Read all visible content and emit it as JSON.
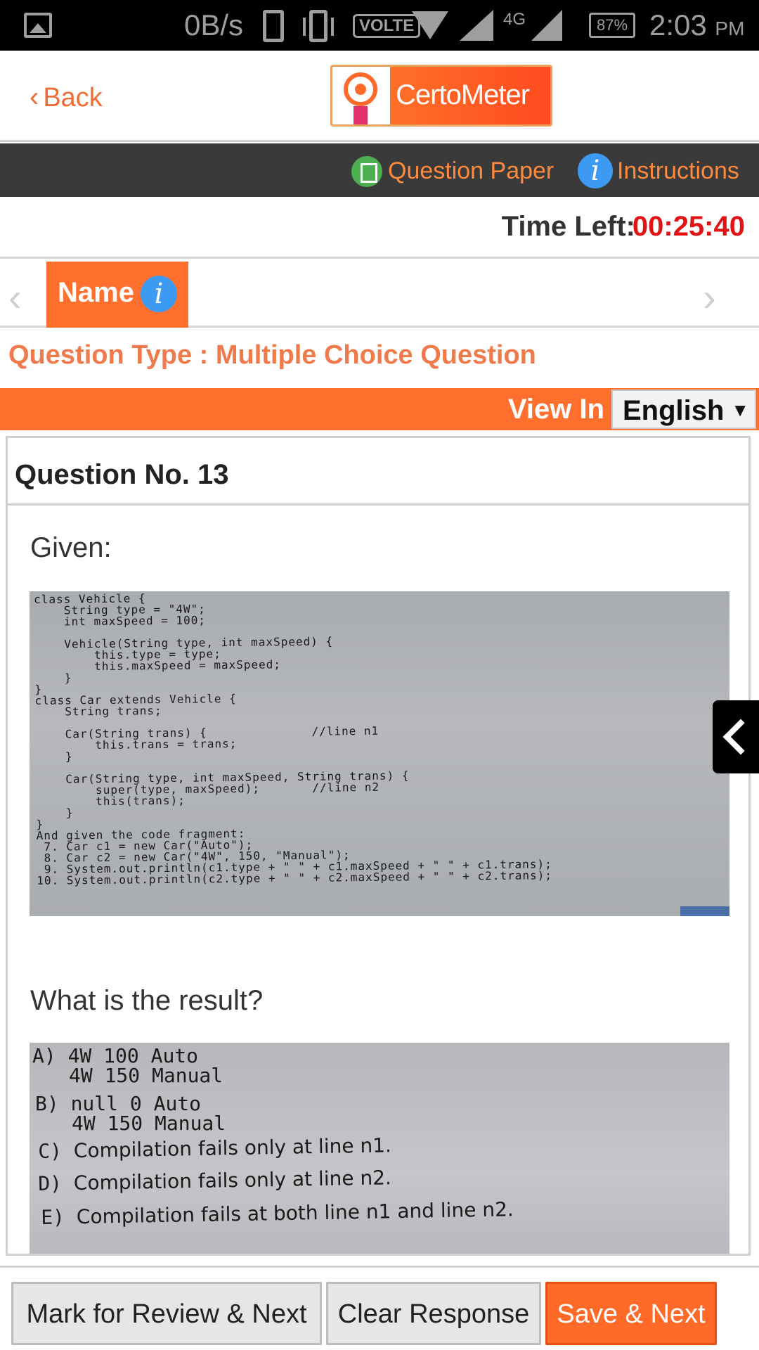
{
  "status_bar": {
    "speed": "0B/s",
    "volte": "VOLTE",
    "network": "4G",
    "battery": "87%",
    "time": "2:03",
    "ampm": "PM"
  },
  "header": {
    "back_label": "Back",
    "brand": "CertoMeter"
  },
  "toolbar": {
    "question_paper_label": "Question Paper",
    "instructions_label": "Instructions"
  },
  "timer": {
    "label": "Time Left:",
    "value": "00:25:40"
  },
  "section_tab": {
    "name": "Name"
  },
  "question_type": "Question Type : Multiple Choice Question",
  "view_in": {
    "label": "View In",
    "language": "English"
  },
  "question": {
    "number_label": "Question No. 13",
    "given": "Given:",
    "code": "class Vehicle {\n    String type = \"4W\";\n    int maxSpeed = 100;\n\n    Vehicle(String type, int maxSpeed) {\n        this.type = type;\n        this.maxSpeed = maxSpeed;\n    }\n}\nclass Car extends Vehicle {\n    String trans;\n\n    Car(String trans) {              //line n1\n        this.trans = trans;\n    }\n\n    Car(String type, int maxSpeed, String trans) {\n        super(type, maxSpeed);       //line n2\n        this(trans);\n    }\n}\nAnd given the code fragment:\n 7. Car c1 = new Car(\"Auto\");\n 8. Car c2 = new Car(\"4W\", 150, \"Manual\");\n 9. System.out.println(c1.type + \" \" + c1.maxSpeed + \" \" + c1.trans);\n10. System.out.println(c2.type + \" \" + c2.maxSpeed + \" \" + c2.trans);",
    "prompt": "What is the result?",
    "options": [
      {
        "letter": "A)",
        "line1": "4W 100 Auto",
        "line2": "4W 150 Manual"
      },
      {
        "letter": "B)",
        "line1": "null 0 Auto",
        "line2": "4W 150 Manual"
      },
      {
        "letter": "C)",
        "text": "Compilation fails only at line n1."
      },
      {
        "letter": "D)",
        "text": "Compilation fails only at line n2."
      },
      {
        "letter": "E)",
        "text": "Compilation fails at both line n1 and line n2."
      }
    ]
  },
  "actions": {
    "review": "Mark for Review & Next",
    "clear": "Clear Response",
    "save": "Save & Next"
  },
  "colors": {
    "accent": "#ff6f2d",
    "timer": "#e01414",
    "toolbar_bg": "#3a3a3a",
    "info_blue": "#3d9af2"
  }
}
